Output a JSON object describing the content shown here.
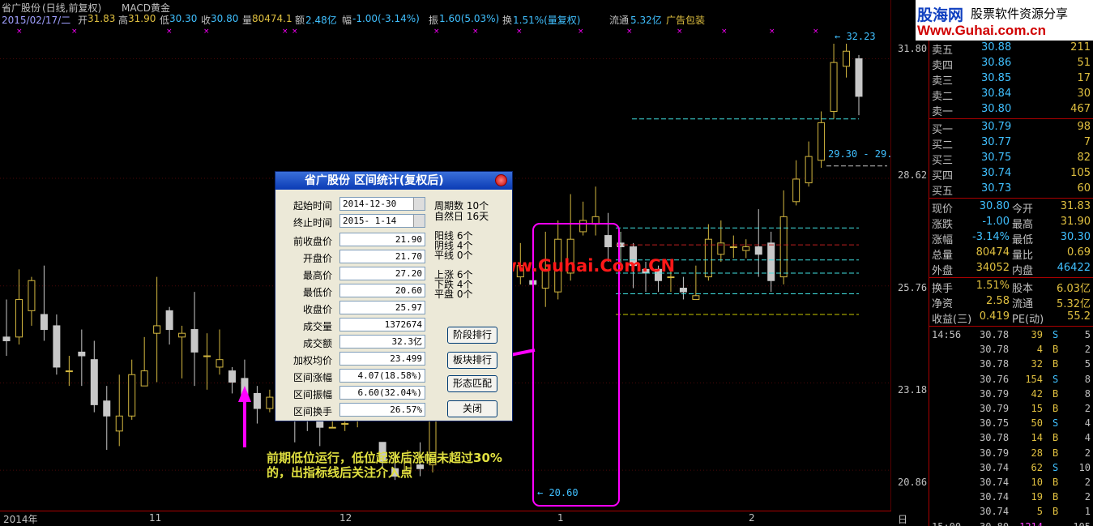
{
  "header": {
    "title": "省广股份",
    "mode": "(日线,前复权)",
    "indicator": "MACD黄金",
    "date": "2015/02/17/二",
    "open_label": "开",
    "open": "31.83",
    "high_label": "高",
    "high": "31.90",
    "low_label": "低",
    "low": "30.30",
    "close_label": "收",
    "close": "30.80",
    "vol_label": "量",
    "vol": "80474.1",
    "amt_label": "额",
    "amt": "2.48亿",
    "chg_label": "幅",
    "chg": "-1.00(-3.14%)",
    "amp_label": "振",
    "amp": "1.60(5.03%)",
    "turn_label": "换",
    "turn": "1.51%(量复权)",
    "float_label": "流通",
    "float": "5.32亿",
    "ad": "广告包装"
  },
  "price_axis": [
    "31.80",
    "28.62",
    "25.76",
    "23.18",
    "20.86"
  ],
  "date_axis": [
    "2014年",
    "11",
    "12",
    "1",
    "2",
    "日线"
  ],
  "chart_labels": {
    "max": "32.23",
    "min": "20.60",
    "range": "29.30 - 29."
  },
  "colors": {
    "up": "#d4b840",
    "down": "#c8c8c8",
    "accent": "#ff00ff",
    "cyan": "#40e0e0",
    "red_line": "#c02020",
    "yellow_line": "#c8c800"
  },
  "chart_data": {
    "type": "candlestick",
    "ylim": [
      20.0,
      32.5
    ],
    "candles": [
      [
        24.4,
        24.3,
        25.4,
        23.9,
        "d"
      ],
      [
        24.4,
        25.4,
        26.2,
        24.2,
        "u"
      ],
      [
        25.1,
        25.9,
        26.0,
        24.7,
        "u"
      ],
      [
        25.0,
        24.6,
        26.3,
        24.3,
        "d"
      ],
      [
        24.7,
        23.6,
        25.0,
        23.4,
        "d"
      ],
      [
        23.5,
        23.5,
        23.9,
        23.1,
        "d"
      ],
      [
        24.0,
        23.9,
        24.6,
        23.1,
        "d"
      ],
      [
        23.8,
        22.6,
        24.3,
        22.4,
        "d"
      ],
      [
        22.7,
        22.3,
        23.1,
        21.4,
        "d"
      ],
      [
        21.9,
        22.3,
        23.4,
        21.5,
        "u"
      ],
      [
        22.3,
        23.4,
        23.8,
        22.2,
        "u"
      ],
      [
        23.1,
        23.5,
        24.4,
        23.1,
        "u"
      ],
      [
        24.5,
        24.7,
        26.0,
        23.2,
        "u"
      ],
      [
        25.1,
        24.6,
        25.2,
        24.2,
        "d"
      ],
      [
        24.4,
        24.5,
        24.7,
        23.3,
        "u"
      ],
      [
        24.6,
        24.0,
        25.6,
        23.1,
        "d"
      ],
      [
        23.9,
        23.9,
        24.5,
        23.0,
        "d"
      ],
      [
        23.6,
        23.8,
        24.6,
        23.4,
        "u"
      ],
      [
        23.5,
        23.2,
        23.6,
        22.9,
        "d"
      ],
      [
        23.3,
        22.7,
        23.8,
        22.4,
        "d"
      ],
      [
        22.9,
        22.5,
        23.1,
        22.1,
        "d"
      ],
      [
        22.5,
        22.8,
        23.0,
        22.4,
        "u"
      ],
      [
        22.7,
        22.5,
        22.9,
        22.3,
        "d"
      ],
      [
        22.5,
        22.3,
        22.6,
        21.6,
        "d"
      ],
      [
        22.3,
        22.2,
        22.6,
        21.9,
        "u"
      ],
      [
        22.3,
        22.0,
        22.4,
        21.5,
        "d"
      ],
      [
        22.0,
        22.0,
        22.6,
        22.0,
        "u"
      ],
      [
        22.1,
        22.1,
        22.5,
        21.9,
        "u"
      ],
      [
        22.2,
        22.6,
        22.9,
        22.0,
        "u"
      ],
      [
        22.6,
        22.9,
        23.2,
        22.5,
        "u"
      ],
      [
        21.6,
        21.1,
        21.6,
        20.9,
        "d"
      ],
      [
        20.9,
        20.7,
        21.3,
        20.6,
        "d"
      ],
      [
        20.8,
        21.1,
        21.4,
        20.7,
        "u"
      ],
      [
        21.0,
        20.9,
        21.6,
        20.7,
        "d"
      ],
      [
        21.0,
        22.3,
        23.0,
        20.8,
        "u"
      ],
      [
        22.9,
        23.2,
        23.5,
        22.9,
        "d"
      ],
      [
        22.9,
        22.9,
        23.1,
        22.7,
        "u"
      ],
      [
        23.1,
        23.2,
        23.4,
        22.9,
        "u"
      ],
      [
        22.9,
        23.5,
        24.0,
        22.8,
        "u"
      ],
      [
        23.8,
        24.4,
        24.6,
        23.4,
        "u"
      ],
      [
        24.3,
        25.9,
        26.5,
        24.0,
        "u"
      ],
      [
        26.0,
        26.3,
        26.9,
        25.8,
        "u"
      ],
      [
        25.9,
        25.8,
        26.1,
        25.1,
        "d"
      ],
      [
        25.7,
        26.2,
        27.2,
        25.2,
        "u"
      ],
      [
        25.6,
        27.0,
        27.5,
        25.4,
        "u"
      ],
      [
        26.1,
        27.0,
        28.2,
        25.9,
        "u"
      ],
      [
        27.2,
        27.5,
        28.0,
        27.1,
        "u"
      ],
      [
        27.4,
        27.6,
        28.4,
        27.1,
        "u"
      ],
      [
        27.1,
        26.8,
        27.7,
        26.4,
        "d"
      ],
      [
        26.9,
        26.8,
        27.2,
        26.3,
        "d"
      ],
      [
        26.8,
        26.3,
        26.9,
        25.7,
        "d"
      ],
      [
        26.2,
        26.1,
        26.4,
        25.6,
        "d"
      ],
      [
        26.2,
        25.9,
        26.3,
        25.6,
        "d"
      ],
      [
        26.0,
        26.0,
        26.2,
        25.6,
        "d"
      ],
      [
        25.7,
        25.6,
        26.0,
        25.4,
        "d"
      ],
      [
        25.4,
        25.5,
        26.3,
        25.4,
        "u"
      ],
      [
        26.0,
        27.0,
        27.4,
        25.9,
        "u"
      ],
      [
        26.6,
        26.9,
        27.5,
        26.4,
        "u"
      ],
      [
        26.8,
        26.8,
        27.1,
        26.5,
        "d"
      ],
      [
        26.7,
        26.8,
        27.0,
        26.5,
        "u"
      ],
      [
        26.8,
        26.6,
        27.8,
        26.0,
        "d"
      ],
      [
        26.9,
        25.9,
        27.2,
        25.6,
        "d"
      ],
      [
        26.0,
        27.6,
        28.3,
        25.8,
        "u"
      ],
      [
        28.0,
        28.6,
        29.1,
        27.9,
        "u"
      ],
      [
        28.5,
        29.2,
        29.6,
        28.4,
        "u"
      ],
      [
        29.1,
        30.1,
        30.4,
        28.9,
        "u"
      ],
      [
        30.4,
        31.7,
        32.2,
        30.2,
        "u"
      ],
      [
        31.6,
        32.0,
        32.2,
        31.3,
        "d"
      ],
      [
        31.8,
        30.8,
        31.9,
        30.3,
        "d"
      ]
    ]
  },
  "dialog": {
    "title": "省广股份 区间统计(复权后)",
    "fields": [
      {
        "label": "起始时间",
        "value": "2014-12-30"
      },
      {
        "label": "终止时间",
        "value": "2015- 1-14"
      },
      {
        "label": "前收盘价",
        "value": "21.90"
      },
      {
        "label": "开盘价",
        "value": "21.70"
      },
      {
        "label": "最高价",
        "value": "27.20"
      },
      {
        "label": "最低价",
        "value": "20.60"
      },
      {
        "label": "收盘价",
        "value": "25.97"
      },
      {
        "label": "成交量",
        "value": "1372674"
      },
      {
        "label": "成交额",
        "value": "32.3亿"
      },
      {
        "label": "加权均价",
        "value": "23.499"
      },
      {
        "label": "区间涨幅",
        "value": "4.07(18.58%)"
      },
      {
        "label": "区间振幅",
        "value": "6.60(32.04%)"
      },
      {
        "label": "区间换手",
        "value": "26.57%"
      }
    ],
    "info": [
      "周期数 10个",
      "自然日 16天",
      "阳线 6个",
      "阴线 4个",
      "平线 0个",
      "上涨 6个",
      "下跌 4个",
      "平盘 0个"
    ],
    "buttons": [
      "阶段排行",
      "板块排行",
      "形态匹配",
      "关闭"
    ]
  },
  "watermark": "股海网提供 Www.Guhai.Com.CN",
  "annotation": "前期低位运行，低位起涨后涨幅未超过30%的，出指标线后关注介入点",
  "logo": {
    "name": "股海网",
    "slogan": "股票软件资源分享",
    "url": "Www.Guhai.com.cn"
  },
  "quote": {
    "sells": [
      {
        "label": "卖五",
        "price": "30.88",
        "vol": "211"
      },
      {
        "label": "卖四",
        "price": "30.86",
        "vol": "51"
      },
      {
        "label": "卖三",
        "price": "30.85",
        "vol": "17"
      },
      {
        "label": "卖二",
        "price": "30.84",
        "vol": "30"
      },
      {
        "label": "卖一",
        "price": "30.80",
        "vol": "467"
      }
    ],
    "buys": [
      {
        "label": "买一",
        "price": "30.79",
        "vol": "98"
      },
      {
        "label": "买二",
        "price": "30.77",
        "vol": "7"
      },
      {
        "label": "买三",
        "price": "30.75",
        "vol": "82"
      },
      {
        "label": "买四",
        "price": "30.74",
        "vol": "105"
      },
      {
        "label": "买五",
        "price": "30.73",
        "vol": "60"
      }
    ],
    "stats": [
      {
        "l1": "现价",
        "v1": "30.80",
        "l2": "今开",
        "v2": "31.83"
      },
      {
        "l1": "涨跌",
        "v1": "-1.00",
        "l2": "最高",
        "v2": "31.90"
      },
      {
        "l1": "涨幅",
        "v1": "-3.14%",
        "l2": "最低",
        "v2": "30.30"
      },
      {
        "l1": "总量",
        "v1": "80474",
        "l2": "量比",
        "v2": "0.69"
      },
      {
        "l1": "外盘",
        "v1": "34052",
        "l2": "内盘",
        "v2": "46422"
      }
    ],
    "fin": [
      {
        "l1": "换手",
        "v1": "1.51%",
        "l2": "股本",
        "v2": "6.03亿"
      },
      {
        "l1": "净资",
        "v1": "2.58",
        "l2": "流通",
        "v2": "5.32亿"
      },
      {
        "l1": "收益(三)",
        "v1": "0.419",
        "l2": "PE(动)",
        "v2": "55.2"
      }
    ],
    "ticks": [
      {
        "time": "14:56",
        "price": "30.78",
        "vol": "39",
        "bs": "S",
        "n": "5"
      },
      {
        "time": "",
        "price": "30.78",
        "vol": "4",
        "bs": "B",
        "n": "2"
      },
      {
        "time": "",
        "price": "30.78",
        "vol": "32",
        "bs": "B",
        "n": "5"
      },
      {
        "time": "",
        "price": "30.76",
        "vol": "154",
        "bs": "S",
        "n": "8"
      },
      {
        "time": "",
        "price": "30.79",
        "vol": "42",
        "bs": "B",
        "n": "8"
      },
      {
        "time": "",
        "price": "30.79",
        "vol": "15",
        "bs": "B",
        "n": "2"
      },
      {
        "time": "",
        "price": "30.75",
        "vol": "50",
        "bs": "S",
        "n": "4"
      },
      {
        "time": "",
        "price": "30.78",
        "vol": "14",
        "bs": "B",
        "n": "4"
      },
      {
        "time": "",
        "price": "30.79",
        "vol": "28",
        "bs": "B",
        "n": "2"
      },
      {
        "time": "",
        "price": "30.74",
        "vol": "62",
        "bs": "S",
        "n": "10"
      },
      {
        "time": "",
        "price": "30.74",
        "vol": "10",
        "bs": "B",
        "n": "2"
      },
      {
        "time": "",
        "price": "30.74",
        "vol": "19",
        "bs": "B",
        "n": "2"
      },
      {
        "time": "",
        "price": "30.74",
        "vol": "5",
        "bs": "B",
        "n": "1"
      },
      {
        "time": "15:00",
        "price": "30.80",
        "vol": "1214",
        "bs": "",
        "n": "105"
      }
    ]
  }
}
